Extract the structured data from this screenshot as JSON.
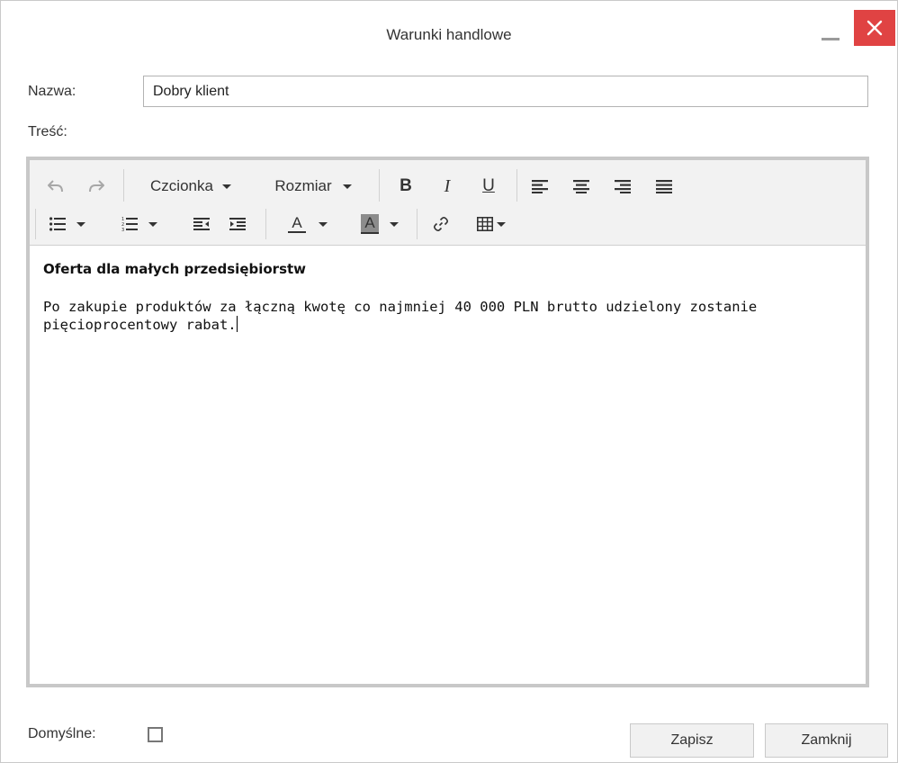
{
  "window": {
    "title": "Warunki handlowe"
  },
  "form": {
    "name_label": "Nazwa:",
    "name_value": "Dobry klient",
    "content_label": "Treść:",
    "default_label": "Domyślne:",
    "default_checked": false
  },
  "toolbar": {
    "font_label": "Czcionka",
    "size_label": "Rozmiar",
    "bold_label": "B",
    "italic_label": "I",
    "underline_label": "U",
    "text_color_label": "A",
    "background_color_label": "A",
    "icons": [
      "undo-icon",
      "redo-icon",
      "align-left-icon",
      "align-center-icon",
      "align-right-icon",
      "align-justify-icon",
      "bullet-list-icon",
      "numbered-list-icon",
      "outdent-icon",
      "indent-icon",
      "link-icon",
      "table-icon"
    ]
  },
  "editor": {
    "heading": "Oferta dla małych przedsiębiorstw",
    "body": "Po zakupie produktów za łączną kwotę co najmniej 40 000 PLN brutto udzielony zostanie pięcioprocentowy rabat."
  },
  "buttons": {
    "save_label": "Zapisz",
    "close_label": "Zamknij"
  },
  "colors": {
    "close_button": "#e04343",
    "toolbar_bg": "#f2f2f2",
    "editor_border": "#c8c8c8"
  }
}
